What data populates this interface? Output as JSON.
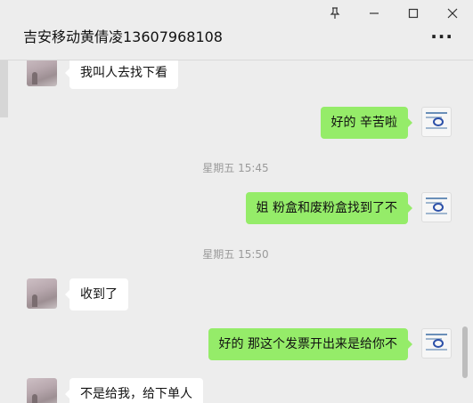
{
  "window": {
    "title": "吉安移动黄倩凌13607968108",
    "pin_icon": "pin-icon",
    "minimize_icon": "minimize-icon",
    "maximize_icon": "maximize-icon",
    "close_icon": "close-icon",
    "more_icon": "more-options-icon"
  },
  "messages": [
    {
      "side": "left",
      "text": "我叫人去找下看"
    },
    {
      "side": "right",
      "text": "好的 辛苦啦"
    },
    {
      "side": "time",
      "text": "星期五 15:45"
    },
    {
      "side": "right",
      "text": "姐 粉盒和废粉盒找到了不"
    },
    {
      "side": "time",
      "text": "星期五 15:50"
    },
    {
      "side": "left",
      "text": "收到了"
    },
    {
      "side": "right",
      "text": "好的 那这个发票开出来是给你不"
    },
    {
      "side": "left",
      "text": "不是给我，给下单人"
    }
  ],
  "colors": {
    "outgoing_bubble": "#95ec69",
    "incoming_bubble": "#ffffff",
    "background": "#ededed"
  }
}
